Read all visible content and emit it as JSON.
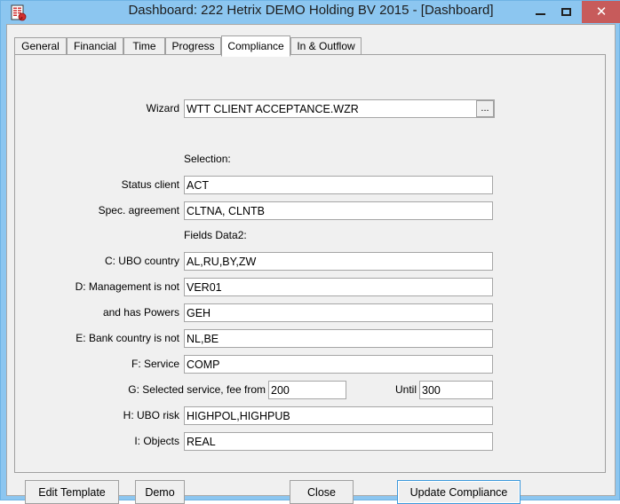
{
  "window": {
    "title": "Dashboard: 222 Hetrix DEMO Holding BV 2015 - [Dashboard]",
    "icon": "document-seal-icon",
    "minimize_label": "─",
    "maximize_label": "❐",
    "close_label": "✕",
    "titlebar_color": "#8cc6f0",
    "close_button_color": "#c75b5b"
  },
  "tabs": [
    {
      "label": "General",
      "selected": false
    },
    {
      "label": "Financial",
      "selected": false
    },
    {
      "label": "Time",
      "selected": false
    },
    {
      "label": "Progress",
      "selected": false
    },
    {
      "label": "Compliance",
      "selected": true
    },
    {
      "label": "In & Outflow",
      "selected": false
    }
  ],
  "form": {
    "wizard": {
      "label": "Wizard",
      "value": "WTT CLIENT ACCEPTANCE.WZR",
      "browse_label": "..."
    },
    "selection_header": "Selection:",
    "fields_header": "Fields Data2:",
    "rows": [
      {
        "label": "Status client",
        "value": "ACT"
      },
      {
        "label": "Spec. agreement",
        "value": "CLTNA, CLNTB"
      },
      {
        "label": "C: UBO country",
        "value": "AL,RU,BY,ZW"
      },
      {
        "label": "D: Management is not",
        "value": "VER01"
      },
      {
        "label": "and has Powers",
        "value": "GEH"
      },
      {
        "label": "E: Bank country is not",
        "value": "NL,BE"
      },
      {
        "label": "F: Service",
        "value": "COMP"
      }
    ],
    "fee_row": {
      "label": "G: Selected service, fee from",
      "from_value": "200",
      "until_label": "Until",
      "until_value": "300"
    },
    "rows_tail": [
      {
        "label": "H: UBO risk",
        "value": "HIGHPOL,HIGHPUB"
      },
      {
        "label": "I: Objects",
        "value": "REAL"
      }
    ]
  },
  "buttons": {
    "edit_template": "Edit Template",
    "demo": "Demo",
    "close": "Close",
    "update_compliance": "Update Compliance"
  }
}
